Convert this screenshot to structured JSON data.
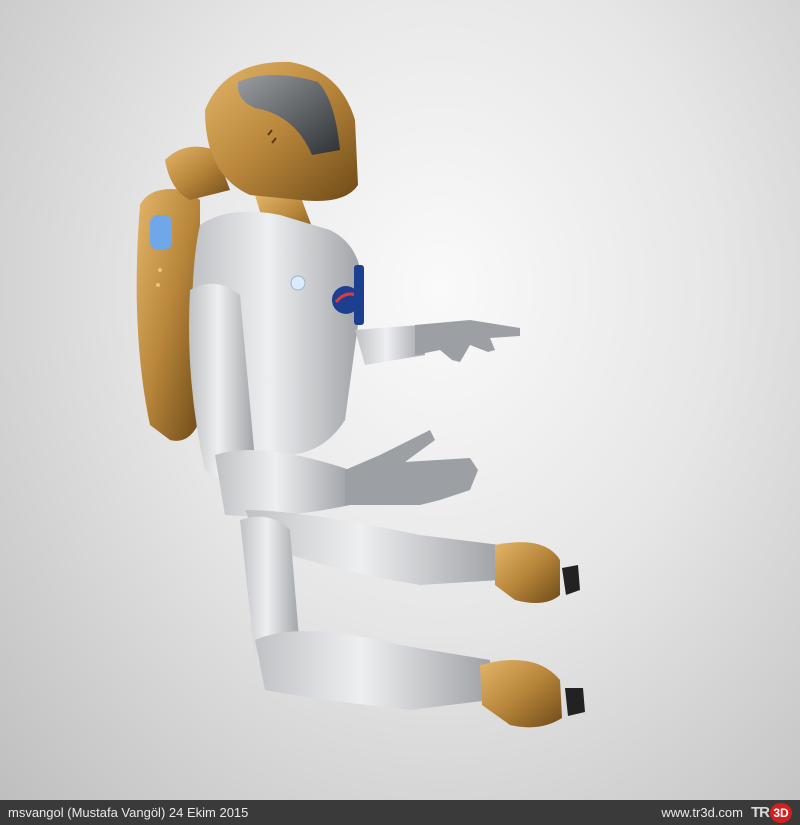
{
  "footer": {
    "credit": "msvangol (Mustafa Vangöl)  24 Ekim 2015",
    "site": "www.tr3d.com"
  },
  "logo": {
    "part1": "TR",
    "part2": "3D"
  },
  "colors": {
    "footer_bg": "#3a3a3a",
    "logo_red": "#d21f1f",
    "gold": "#b8863b"
  }
}
